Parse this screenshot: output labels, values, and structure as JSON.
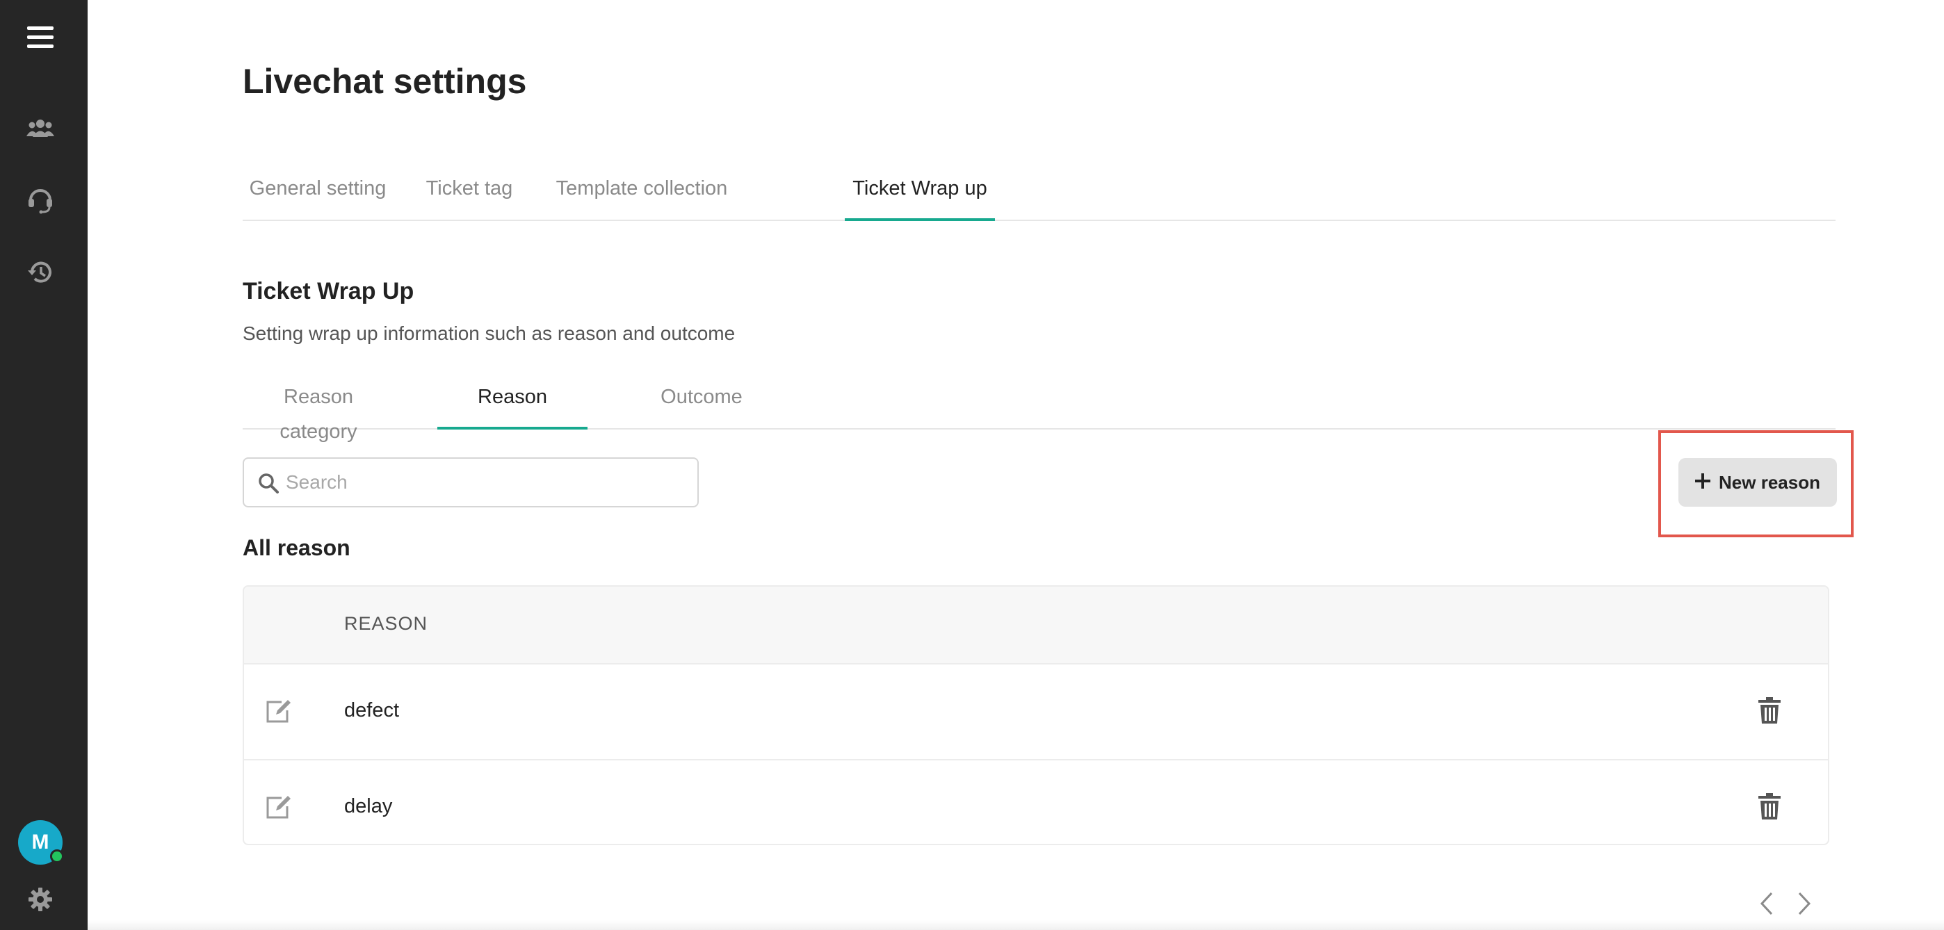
{
  "sidebar": {
    "icons": [
      "menu-icon",
      "team-icon",
      "headset-icon",
      "history-icon",
      "settings-icon"
    ],
    "avatar_initial": "M",
    "colors": {
      "background": "#262626",
      "avatar": "#17a9c9",
      "online": "#23c55e"
    }
  },
  "page": {
    "title": "Livechat settings"
  },
  "top_tabs": [
    {
      "label": "General setting",
      "active": false
    },
    {
      "label": "Ticket tag",
      "active": false
    },
    {
      "label": "Template collection",
      "active": false
    },
    {
      "label": "Ticket Wrap up",
      "active": true
    }
  ],
  "section": {
    "title": "Ticket Wrap Up",
    "description": "Setting wrap up information such as reason and outcome"
  },
  "sub_tabs": [
    {
      "label": "Reason category",
      "active": false
    },
    {
      "label": "Reason",
      "active": true
    },
    {
      "label": "Outcome",
      "active": false
    }
  ],
  "search": {
    "placeholder": "Search",
    "value": ""
  },
  "new_button": {
    "label": "New reason"
  },
  "list": {
    "title": "All reason",
    "column_header": "REASON",
    "rows": [
      {
        "reason": "defect"
      },
      {
        "reason": "delay"
      }
    ]
  },
  "colors": {
    "accent": "#17a98f",
    "highlight": "#e2574c"
  }
}
